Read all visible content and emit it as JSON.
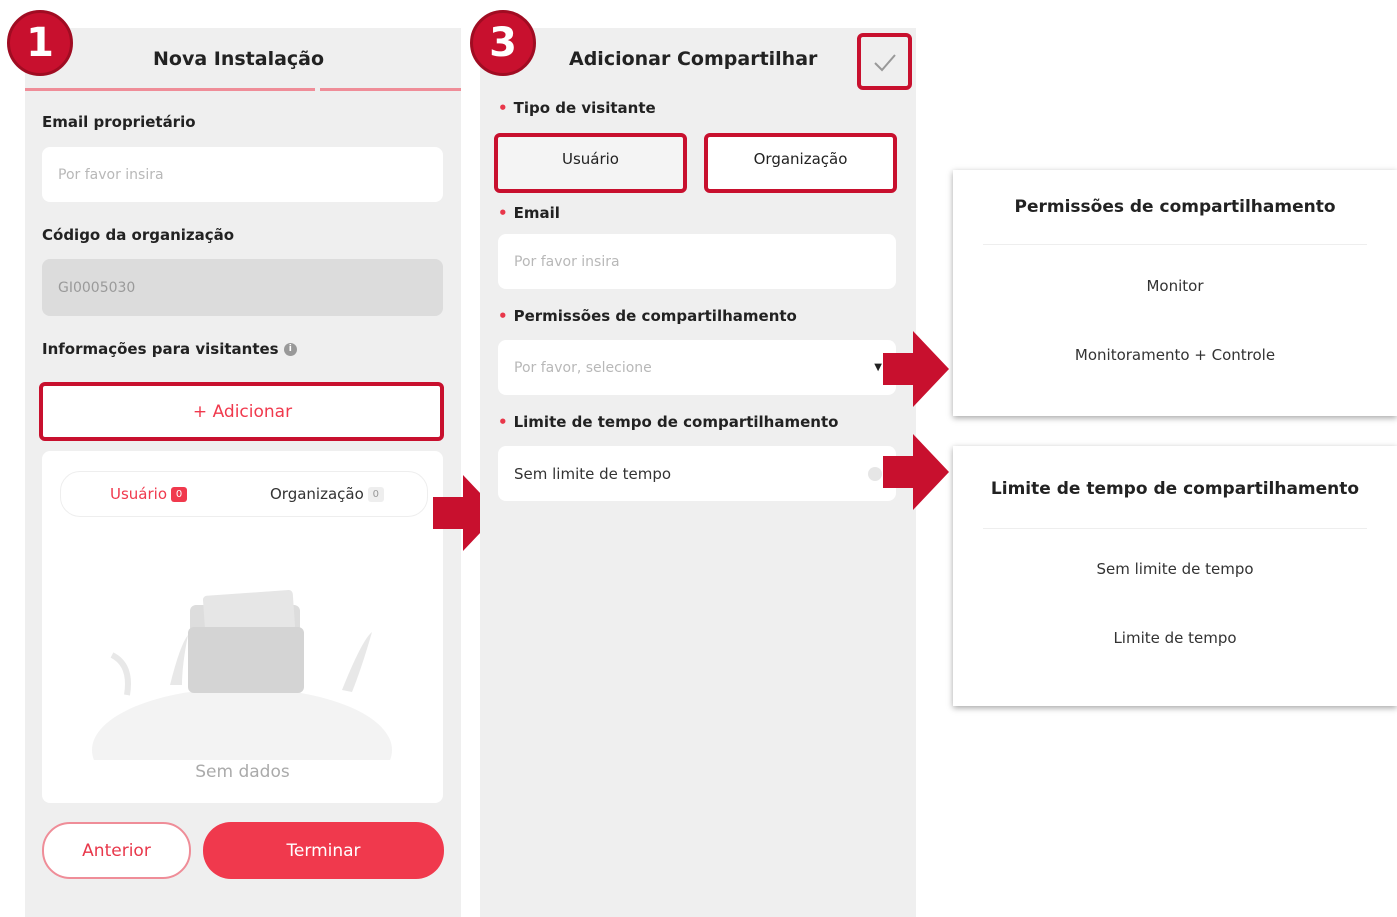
{
  "screen1": {
    "step": "1",
    "title": "Nova Instalação",
    "owner_email_label": "Email proprietário",
    "owner_email_placeholder": "Por favor insira",
    "org_code_label": "Código da organização",
    "org_code_value": "GI0005030",
    "visitor_info_label": "Informações para visitantes",
    "add_button": "+ Adicionar",
    "tabs": [
      {
        "label": "Usuário",
        "count": "0"
      },
      {
        "label": "Organização",
        "count": "0"
      }
    ],
    "empty_text": "Sem dados",
    "prev_button": "Anterior",
    "finish_button": "Terminar"
  },
  "screen3": {
    "step": "3",
    "title": "Adicionar Compartilhar",
    "visitor_type_label": "Tipo de visitante",
    "visitor_type_options": [
      "Usuário",
      "Organização"
    ],
    "email_label": "Email",
    "email_placeholder": "Por favor insira",
    "permissions_label": "Permissões de compartilhamento",
    "permissions_placeholder": "Por favor, selecione",
    "time_limit_label": "Limite de tempo de compartilhamento",
    "time_limit_value": "Sem limite de tempo"
  },
  "permissions_dialog": {
    "title": "Permissões de compartilhamento",
    "options": [
      "Monitor",
      "Monitoramento + Controle"
    ]
  },
  "time_dialog": {
    "title": "Limite de tempo de compartilhamento",
    "options": [
      "Sem limite de tempo",
      "Limite de tempo"
    ]
  },
  "colors": {
    "accent": "#f0394d",
    "highlight": "#c8102e"
  }
}
